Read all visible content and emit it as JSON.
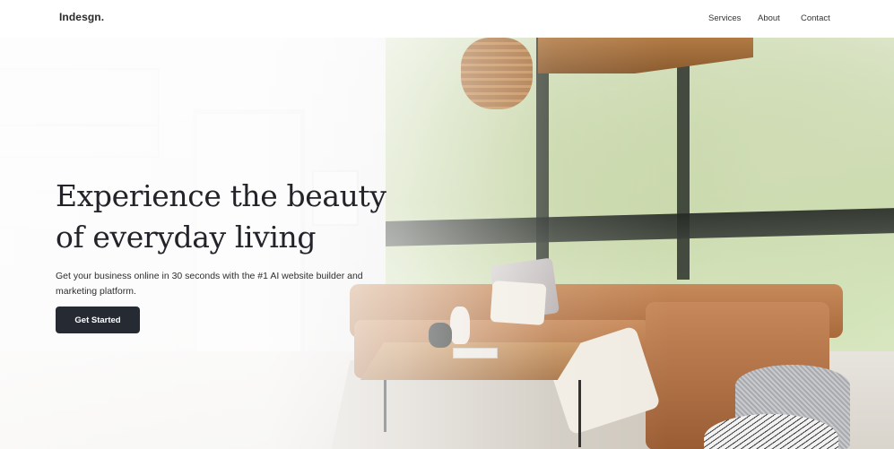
{
  "header": {
    "logo": "Indesgn.",
    "nav": [
      {
        "label": "Services"
      },
      {
        "label": "About"
      },
      {
        "label": "Contact"
      }
    ]
  },
  "hero": {
    "title_line1": "Experience the beauty",
    "title_line2": "of everyday living",
    "subtitle": "Get your business online in 30 seconds with the #1 AI website builder and marketing platform.",
    "cta_label": "Get Started",
    "image_description": "",
    "colors": {
      "cta_background": "#262b33",
      "cta_text": "#ffffff",
      "title_text": "#23232a"
    }
  }
}
